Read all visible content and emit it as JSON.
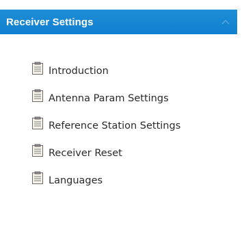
{
  "header": {
    "title": "Receiver Settings"
  },
  "menu": {
    "items": [
      {
        "label": "Introduction",
        "icon": "document-icon"
      },
      {
        "label": "Antenna Param Settings",
        "icon": "document-icon"
      },
      {
        "label": "Reference Station Settings",
        "icon": "document-icon"
      },
      {
        "label": "Receiver Reset",
        "icon": "document-icon"
      },
      {
        "label": "Languages",
        "icon": "document-icon"
      }
    ]
  },
  "colors": {
    "header_bg": "#1481d2",
    "header_text": "#ffffff",
    "item_text": "#2a2a2a"
  }
}
